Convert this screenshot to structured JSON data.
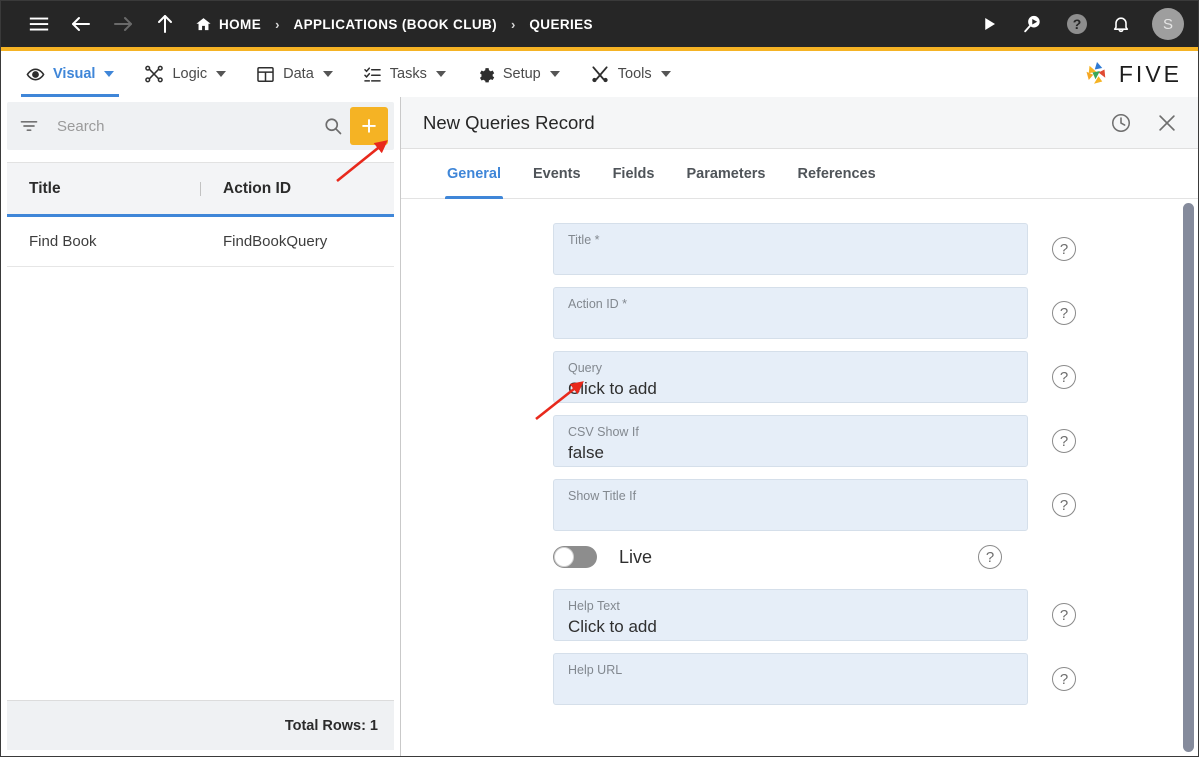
{
  "topbar": {
    "menu_icon": "hamburger-icon",
    "back_icon": "arrow-left-icon",
    "forward_icon": "arrow-right-icon",
    "up_icon": "arrow-up-icon",
    "breadcrumbs": [
      {
        "label": "HOME",
        "icon": "home-icon"
      },
      {
        "label": "APPLICATIONS (BOOK CLUB)",
        "icon": ""
      },
      {
        "label": "QUERIES",
        "icon": ""
      }
    ],
    "separator": "›",
    "right_icons": [
      "run-icon",
      "search-run-icon",
      "help-icon",
      "notifications-icon"
    ],
    "avatar_initial": "S",
    "accent_color": "#f5b324"
  },
  "menubar": {
    "items": [
      {
        "label": "Visual",
        "icon": "eye-icon",
        "active": true
      },
      {
        "label": "Logic",
        "icon": "flow-icon",
        "active": false
      },
      {
        "label": "Data",
        "icon": "table-icon",
        "active": false
      },
      {
        "label": "Tasks",
        "icon": "tasks-icon",
        "active": false
      },
      {
        "label": "Setup",
        "icon": "gear-icon",
        "active": false
      },
      {
        "label": "Tools",
        "icon": "tools-icon",
        "active": false
      }
    ],
    "brand": "FIVE",
    "active_color": "#3f86d8"
  },
  "left_panel": {
    "search": {
      "placeholder": "Search",
      "value": ""
    },
    "filter_icon": "filter-icon",
    "search_icon": "search-icon",
    "add_button_label": "+",
    "add_button_color": "#f5b324",
    "table": {
      "columns": [
        "Title",
        "Action ID"
      ],
      "rows": [
        {
          "title": "Find Book",
          "action_id": "FindBookQuery"
        }
      ]
    },
    "footer": {
      "total_rows_label": "Total Rows: 1"
    }
  },
  "record_panel": {
    "title": "New Queries Record",
    "history_icon": "history-clock-icon",
    "close_icon": "close-icon",
    "tabs": [
      {
        "label": "General",
        "active": true
      },
      {
        "label": "Events",
        "active": false
      },
      {
        "label": "Fields",
        "active": false
      },
      {
        "label": "Parameters",
        "active": false
      },
      {
        "label": "References",
        "active": false
      }
    ],
    "fields": [
      {
        "label": "Title *",
        "value": "",
        "help": "?"
      },
      {
        "label": "Action ID *",
        "value": "",
        "help": "?"
      },
      {
        "label": "Query",
        "value": "Click to add",
        "help": "?"
      },
      {
        "label": "CSV Show If",
        "value": "false",
        "help": "?"
      },
      {
        "label": "Show Title If",
        "value": "",
        "help": "?"
      }
    ],
    "toggle": {
      "label": "Live",
      "on": false,
      "help": "?"
    },
    "fields_after_toggle": [
      {
        "label": "Help Text",
        "value": "Click to add",
        "help": "?"
      },
      {
        "label": "Help URL",
        "value": "",
        "help": "?"
      }
    ]
  },
  "annotations": [
    {
      "name": "arrow-to-add-button",
      "color": "#e8291c"
    },
    {
      "name": "arrow-to-query-field",
      "color": "#e8291c"
    }
  ]
}
